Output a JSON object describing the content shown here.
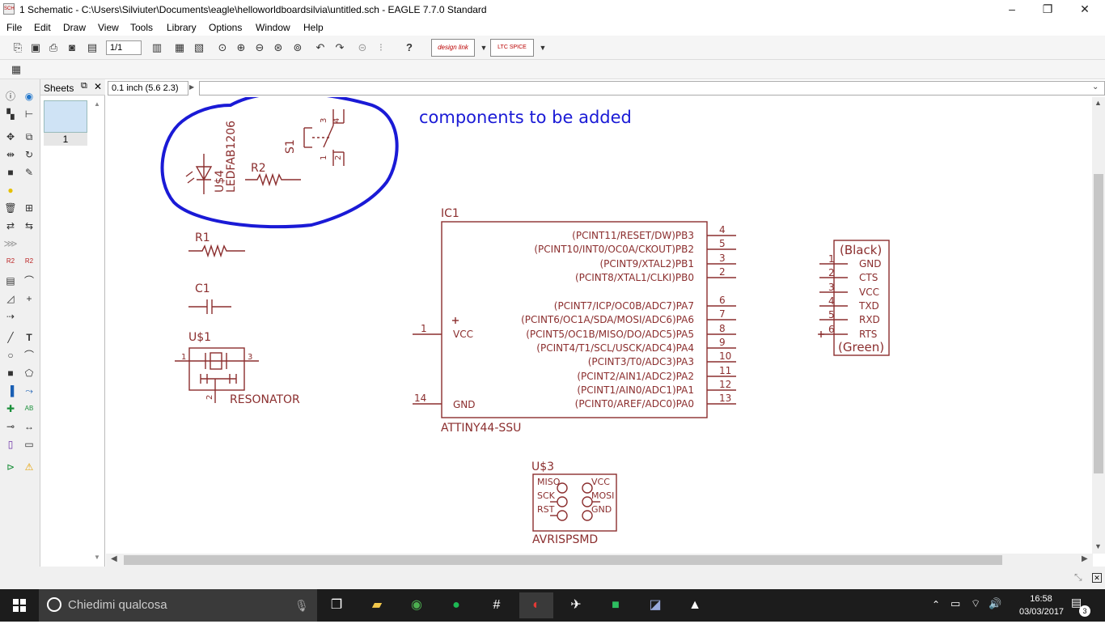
{
  "window": {
    "title": "1 Schematic - C:\\Users\\Silviuter\\Documents\\eagle\\helloworldboardsilvia\\untitled.sch - EAGLE 7.7.0 Standard",
    "minimize": "–",
    "maximize": "❐",
    "close": "✕"
  },
  "menu": [
    "File",
    "Edit",
    "Draw",
    "View",
    "Tools",
    "Library",
    "Options",
    "Window",
    "Help"
  ],
  "toolbar": {
    "sheet_select": "1/1",
    "designlink_label": "design link",
    "ltspice_label": "LTC SPICE"
  },
  "sheets_panel": {
    "title": "Sheets",
    "sheet_number": "1"
  },
  "coord_display": "0.1 inch (5.6 2.3)",
  "command_input": "",
  "annotation": {
    "text": "components to be added",
    "color": "#1a1ad6"
  },
  "schematic": {
    "part_color": "#8b2e2e",
    "circled_parts": {
      "led_name": "U$4",
      "led_value": "LEDFAB1206",
      "resistor2": "R2",
      "switch": "S1",
      "switch_pins": [
        "1",
        "2",
        "3",
        "4"
      ]
    },
    "r1": "R1",
    "c1": "C1",
    "resonator": {
      "name": "U$1",
      "value": "RESONATOR",
      "pins": [
        "1",
        "2",
        "3"
      ]
    },
    "ic1": {
      "name": "IC1",
      "value": "ATTINY44-SSU",
      "right_pins": [
        {
          "label": "(PCINT11/RESET/DW)PB3",
          "num": "4"
        },
        {
          "label": "(PCINT10/INT0/OC0A/CKOUT)PB2",
          "num": "5"
        },
        {
          "label": "(PCINT9/XTAL2)PB1",
          "num": "3"
        },
        {
          "label": "(PCINT8/XTAL1/CLKI)PB0",
          "num": "2"
        },
        {
          "label": "(PCINT7/ICP/OC0B/ADC7)PA7",
          "num": "6"
        },
        {
          "label": "(PCINT6/OC1A/SDA/MOSI/ADC6)PA6",
          "num": "7"
        },
        {
          "label": "(PCINT5/OC1B/MISO/DO/ADC5)PA5",
          "num": "8"
        },
        {
          "label": "(PCINT4/T1/SCL/USCK/ADC4)PA4",
          "num": "9"
        },
        {
          "label": "(PCINT3/T0/ADC3)PA3",
          "num": "10"
        },
        {
          "label": "(PCINT2/AIN1/ADC2)PA2",
          "num": "11"
        },
        {
          "label": "(PCINT1/AIN0/ADC1)PA1",
          "num": "12"
        },
        {
          "label": "(PCINT0/AREF/ADC0)PA0",
          "num": "13"
        }
      ],
      "vcc_label": "VCC",
      "vcc_num": "1",
      "gnd_label": "GND",
      "gnd_num": "14"
    },
    "ftdi": {
      "top_label": "(Black)",
      "bottom_label": "(Green)",
      "pins": [
        {
          "num": "1",
          "label": "GND"
        },
        {
          "num": "2",
          "label": "CTS"
        },
        {
          "num": "3",
          "label": "VCC"
        },
        {
          "num": "4",
          "label": "TXD"
        },
        {
          "num": "5",
          "label": "RXD"
        },
        {
          "num": "6",
          "label": "RTS"
        }
      ]
    },
    "avrisp": {
      "name": "U$3",
      "value": "AVRISPSMD",
      "left_labels": [
        "MISO",
        "SCK",
        "RST"
      ],
      "right_labels": [
        "VCC",
        "MOSI",
        "GND"
      ]
    }
  },
  "taskbar": {
    "search_placeholder": "Chiedimi qualcosa",
    "time": "16:58",
    "date": "03/03/2017",
    "notifications": "3"
  }
}
